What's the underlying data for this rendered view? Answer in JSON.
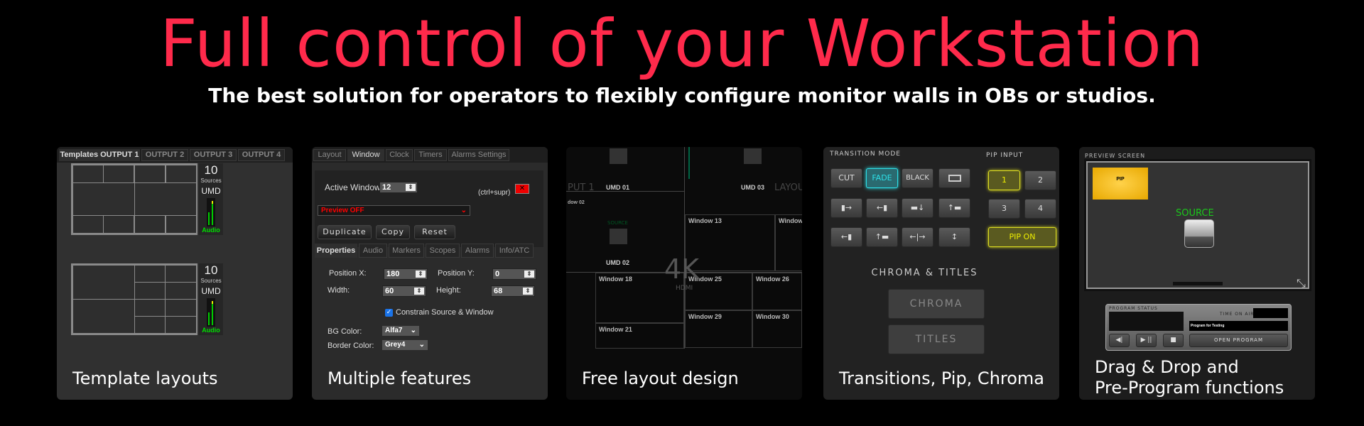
{
  "header": {
    "title": "Full control of your Workstation",
    "subtitle": "The best solution for operators to flexibly configure monitor walls in OBs or studios."
  },
  "colors": {
    "accent": "#ff2a4b",
    "audio_green": "#00e000",
    "fade_cyan": "#2de0e8",
    "pip_yellow": "#e8e82a",
    "pip_bg": "#e8b400"
  },
  "panels": [
    {
      "caption": "Template layouts",
      "tabs": [
        "Templates OUTPUT 1",
        "OUTPUT 2",
        "OUTPUT 3",
        "OUTPUT 4"
      ],
      "templates": [
        {
          "sources": "10",
          "sources_label": "Sources",
          "umd": "UMD",
          "audio": "Audio"
        },
        {
          "sources": "10",
          "sources_label": "Sources",
          "umd": "UMD",
          "audio": "Audio"
        }
      ]
    },
    {
      "caption": "Multiple features",
      "tabs": [
        "Layout",
        "Window",
        "Clock",
        "Timers",
        "Alarms Settings"
      ],
      "active_window_label": "Active Window:",
      "active_window": "12",
      "shortcut": "(ctrl+supr)",
      "preview": "Preview OFF",
      "buttons": [
        "Duplicate",
        "Copy",
        "Reset"
      ],
      "subtabs": [
        "Properties",
        "Audio",
        "Markers",
        "Scopes",
        "Alarms",
        "Info/ATC"
      ],
      "fields": {
        "pos_x_label": "Position X:",
        "pos_x": "180",
        "pos_y_label": "Position Y:",
        "pos_y": "0",
        "width_label": "Width:",
        "width": "60",
        "height_label": "Height:",
        "height": "68"
      },
      "constrain": "Constrain Source & Window",
      "bg_color_label": "BG Color:",
      "bg_color": "Alfa7",
      "border_color_label": "Border Color:",
      "border_color": "Grey4"
    },
    {
      "caption": "Free layout design",
      "umd": [
        "UMD 01",
        "UMD 03",
        "UMD 02"
      ],
      "ghost": [
        "PUT 1",
        "LAYOU"
      ],
      "partial": "dow 02",
      "windows": [
        "Window 13",
        "Window",
        "Window 18",
        "Window 25",
        "Window 26",
        "Window 29",
        "Window 30",
        "Window 21"
      ],
      "badge": "4K",
      "badge_sub": "HDMI",
      "source": "SOURCE"
    },
    {
      "caption": "Transitions, Pip, Chroma",
      "transition_label": "TRANSITION MODE",
      "modes": [
        "CUT",
        "FADE",
        "BLACK"
      ],
      "pip_label": "PIP INPUT",
      "pip_inputs": [
        "1",
        "2",
        "3",
        "4"
      ],
      "pip_on": "PIP ON",
      "chroma_label": "CHROMA & TITLES",
      "chroma": "CHROMA",
      "titles": "TITLES"
    },
    {
      "caption_1": "Drag & Drop and",
      "caption_2": "Pre-Program functions",
      "preview_label": "PREVIEW SCREEN",
      "pip": "PIP",
      "source": "SOURCE",
      "program_status": "PROGRAM STATUS",
      "time_on_air": "TIME ON AIR:",
      "program_name": "Program for Testing",
      "open_program": "OPEN PROGRAM"
    }
  ]
}
